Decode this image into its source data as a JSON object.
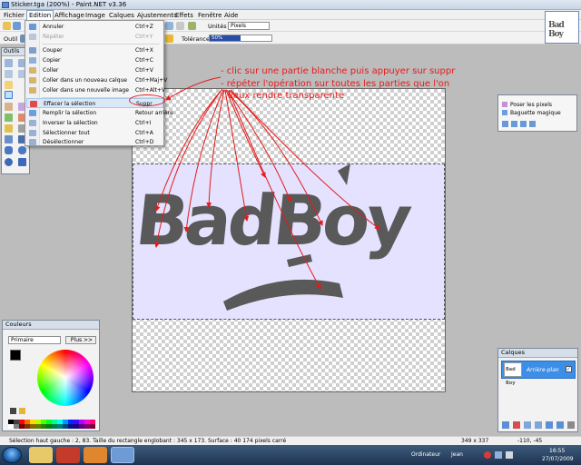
{
  "window": {
    "title": "Sticker.tga (200%) - Paint.NET v3.36"
  },
  "menubar": [
    "Fichier",
    "Edition",
    "Affichage",
    "Image",
    "Calques",
    "Ajustements",
    "Effets",
    "Fenêtre",
    "Aide"
  ],
  "toolbar": {
    "tool_label": "Outil :",
    "units_label": "Unités :",
    "units_value": "Pixels",
    "tolerance_label": "Tolérance :",
    "tolerance_value": "50%",
    "tolerance_fraction": 0.5
  },
  "thumbnail": {
    "text": "Bad Boy"
  },
  "tools_window": {
    "title": "Outils"
  },
  "edit_menu": {
    "items": [
      {
        "label": "Annuler",
        "shortcut": "Ctrl+Z",
        "disabled": false
      },
      {
        "label": "Répéter",
        "shortcut": "Ctrl+Y",
        "disabled": true
      },
      {
        "label": "Couper",
        "shortcut": "Ctrl+X",
        "disabled": false
      },
      {
        "label": "Copier",
        "shortcut": "Ctrl+C",
        "disabled": false
      },
      {
        "label": "Coller",
        "shortcut": "Ctrl+V",
        "disabled": false
      },
      {
        "label": "Coller dans un nouveau calque",
        "shortcut": "Ctrl+Maj+V",
        "disabled": false
      },
      {
        "label": "Coller dans une nouvelle image",
        "shortcut": "Ctrl+Alt+V",
        "disabled": false
      },
      {
        "label": "Effacer la sélection",
        "shortcut": "Suppr",
        "disabled": false,
        "highlighted": true
      },
      {
        "label": "Remplir la sélection",
        "shortcut": "Retour arrière",
        "disabled": false
      },
      {
        "label": "Inverser la sélection",
        "shortcut": "Ctrl+I",
        "disabled": false
      },
      {
        "label": "Sélectionner tout",
        "shortcut": "Ctrl+A",
        "disabled": false
      },
      {
        "label": "Désélectionner",
        "shortcut": "Ctrl+D",
        "disabled": false
      }
    ]
  },
  "annotation": {
    "lines": [
      "- clic sur une partie blanche puis appuyer sur suppr",
      "- répéter l'opération sur toutes les parties que l'on",
      "veux rendre transparente"
    ],
    "color": "#e51a1a"
  },
  "canvas": {
    "logo_text": "BadBoy"
  },
  "history": {
    "items": [
      "Poser les pixels",
      "Baguette magique"
    ]
  },
  "colors_window": {
    "title": "Couleurs",
    "mode": "Primaire",
    "more_button": "Plus >>"
  },
  "layers_window": {
    "title": "Calques",
    "layer_name": "Arrière-plan",
    "thumb_text": "Bad Boy"
  },
  "statusbar": {
    "selection_info": "Sélection haut gauche : 2, 83. Taille du rectangle englobant : 345 x 173. Surface : 40 174 pixels carré",
    "size": "349 x 337",
    "cursor": "-110, -45"
  },
  "taskbar": {
    "computer": "Ordinateur",
    "user": "Jean",
    "time": "16:55",
    "date": "27/07/2009"
  }
}
